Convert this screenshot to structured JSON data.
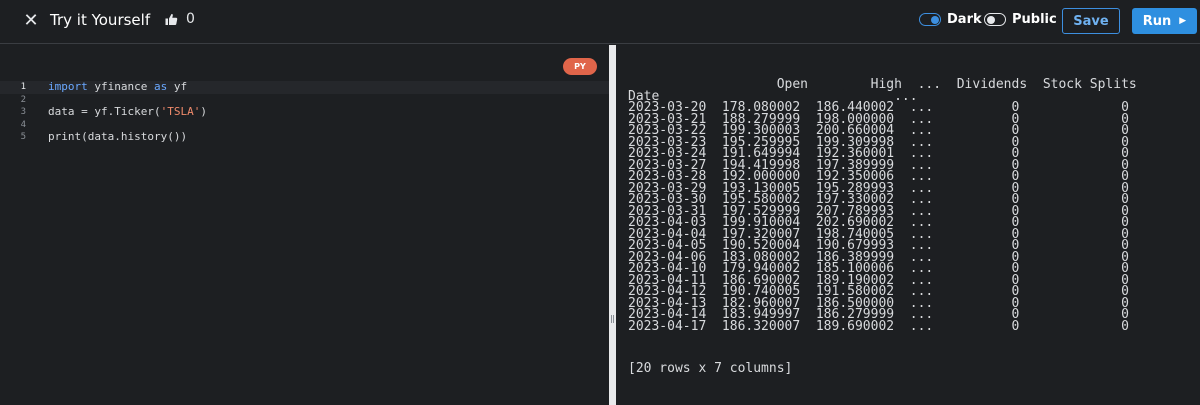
{
  "header": {
    "close_glyph": "✕",
    "title": "Try it Yourself",
    "like_count": "0",
    "dark_label": "Dark",
    "public_label": "Public",
    "save_label": "Save",
    "run_label": "Run",
    "run_glyph": "▶"
  },
  "editor": {
    "language_badge": "PY",
    "active_line": 1,
    "lines": [
      {
        "num": "1",
        "parts": [
          {
            "t": "import",
            "c": "kw"
          },
          {
            "t": " yfinance ",
            "c": ""
          },
          {
            "t": "as",
            "c": "kw"
          },
          {
            "t": " yf",
            "c": ""
          }
        ]
      },
      {
        "num": "2",
        "parts": []
      },
      {
        "num": "3",
        "parts": [
          {
            "t": "data = yf.Ticker(",
            "c": ""
          },
          {
            "t": "'TSLA'",
            "c": "str"
          },
          {
            "t": ")",
            "c": ""
          }
        ]
      },
      {
        "num": "4",
        "parts": []
      },
      {
        "num": "5",
        "parts": [
          {
            "t": "print(data.history())",
            "c": ""
          }
        ]
      }
    ]
  },
  "output": {
    "header_line": "                   Open        High  ...  Dividends  Stock Splits",
    "index_label": "Date",
    "index_ellipsis": "...",
    "rows": [
      [
        "2023-03-20",
        "178.080002",
        "186.440002",
        "...",
        "0",
        "0"
      ],
      [
        "2023-03-21",
        "188.279999",
        "198.000000",
        "...",
        "0",
        "0"
      ],
      [
        "2023-03-22",
        "199.300003",
        "200.660004",
        "...",
        "0",
        "0"
      ],
      [
        "2023-03-23",
        "195.259995",
        "199.309998",
        "...",
        "0",
        "0"
      ],
      [
        "2023-03-24",
        "191.649994",
        "192.360001",
        "...",
        "0",
        "0"
      ],
      [
        "2023-03-27",
        "194.419998",
        "197.389999",
        "...",
        "0",
        "0"
      ],
      [
        "2023-03-28",
        "192.000000",
        "192.350006",
        "...",
        "0",
        "0"
      ],
      [
        "2023-03-29",
        "193.130005",
        "195.289993",
        "...",
        "0",
        "0"
      ],
      [
        "2023-03-30",
        "195.580002",
        "197.330002",
        "...",
        "0",
        "0"
      ],
      [
        "2023-03-31",
        "197.529999",
        "207.789993",
        "...",
        "0",
        "0"
      ],
      [
        "2023-04-03",
        "199.910004",
        "202.690002",
        "...",
        "0",
        "0"
      ],
      [
        "2023-04-04",
        "197.320007",
        "198.740005",
        "...",
        "0",
        "0"
      ],
      [
        "2023-04-05",
        "190.520004",
        "190.679993",
        "...",
        "0",
        "0"
      ],
      [
        "2023-04-06",
        "183.080002",
        "186.389999",
        "...",
        "0",
        "0"
      ],
      [
        "2023-04-10",
        "179.940002",
        "185.100006",
        "...",
        "0",
        "0"
      ],
      [
        "2023-04-11",
        "186.690002",
        "189.190002",
        "...",
        "0",
        "0"
      ],
      [
        "2023-04-12",
        "190.740005",
        "191.580002",
        "...",
        "0",
        "0"
      ],
      [
        "2023-04-13",
        "182.960007",
        "186.500000",
        "...",
        "0",
        "0"
      ],
      [
        "2023-04-14",
        "183.949997",
        "186.279999",
        "...",
        "0",
        "0"
      ],
      [
        "2023-04-17",
        "186.320007",
        "189.690002",
        "...",
        "0",
        "0"
      ]
    ],
    "summary": "[20 rows x 7 columns]"
  },
  "colors": {
    "background": "#1d1f22",
    "accent": "#2e8fe0",
    "badge": "#e0654a",
    "keyword": "#6aa8ff",
    "string": "#ef8a6b"
  }
}
